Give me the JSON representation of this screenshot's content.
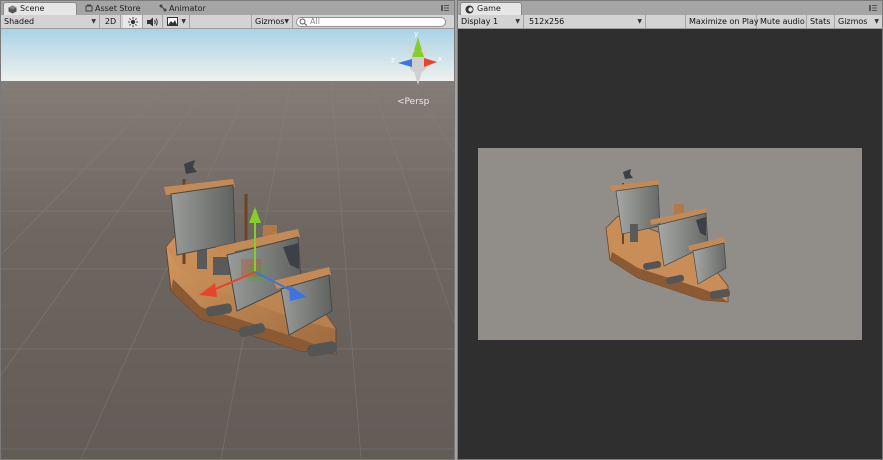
{
  "scene": {
    "tabs": [
      {
        "label": "Scene",
        "active": true,
        "icon": "scene-icon"
      },
      {
        "label": "Asset Store",
        "active": false,
        "icon": "asset-store-icon"
      },
      {
        "label": "Animator",
        "active": false,
        "icon": "animator-icon"
      }
    ],
    "toolbar": {
      "draw_mode": "Shaded",
      "mode_2d": "2D",
      "gizmos_label": "Gizmos",
      "search_placeholder": "All"
    },
    "projection_label": "Persp"
  },
  "game": {
    "tab_label": "Game",
    "toolbar": {
      "display": "Display 1",
      "resolution": "512x256",
      "maximize_on_play": "Maximize on Play",
      "mute_audio": "Mute audio",
      "stats": "Stats",
      "gizmos_label": "Gizmos"
    }
  },
  "colors": {
    "sky_top": "#a9d3e6",
    "sky_bottom": "#f0f0ef",
    "ground": "#6a635e",
    "game_bg": "#2f2f2f",
    "game_canvas": "#918d89",
    "gizmo_x": "#e8442b",
    "gizmo_y": "#86cc2a",
    "gizmo_z": "#3f73dd"
  }
}
